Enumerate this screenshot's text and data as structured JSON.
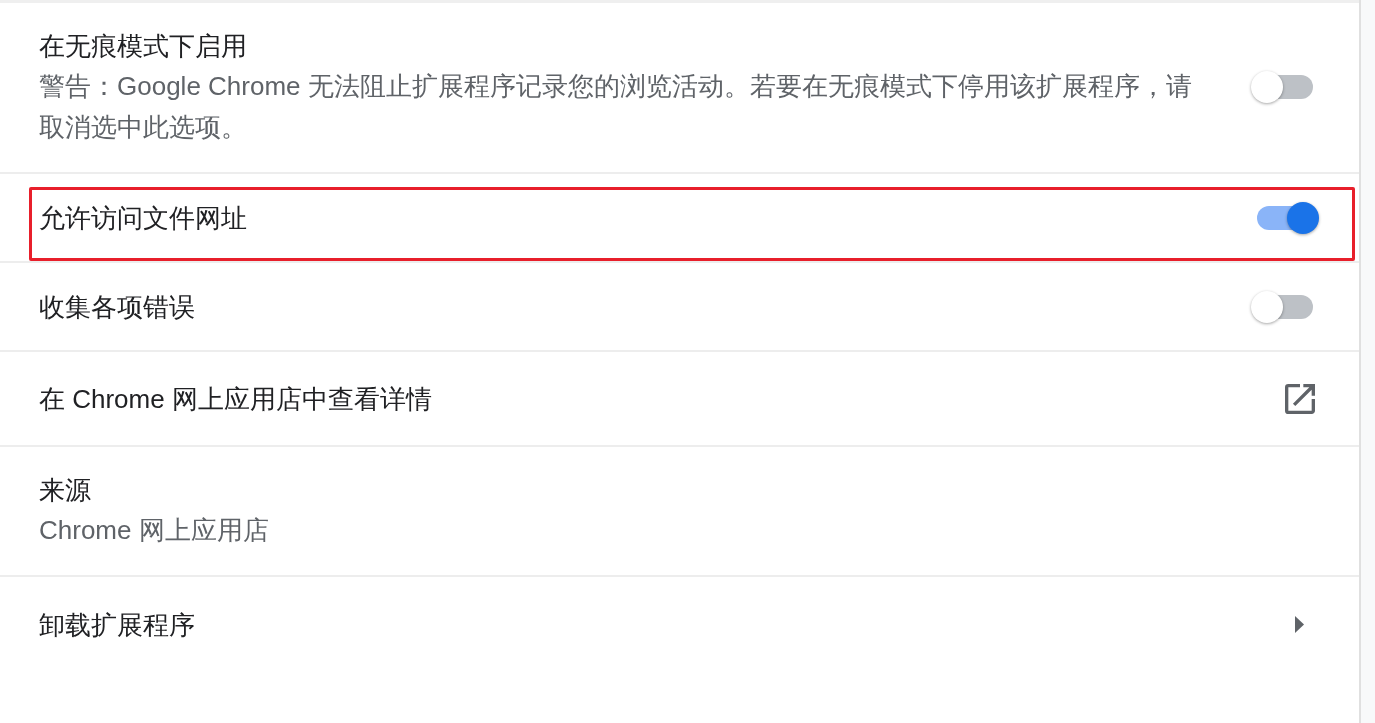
{
  "rows": [
    {
      "kind": "toggle",
      "title": "在无痕模式下启用",
      "description": "警告：Google Chrome 无法阻止扩展程序记录您的浏览活动。若要在无痕模式下停用该扩展程序，请取消选中此选项。",
      "on": false,
      "highlighted": false
    },
    {
      "kind": "toggle",
      "title": "允许访问文件网址",
      "on": true,
      "highlighted": true
    },
    {
      "kind": "toggle",
      "title": "收集各项错误",
      "on": false,
      "highlighted": false
    },
    {
      "kind": "link",
      "title": "在 Chrome 网上应用店中查看详情",
      "highlighted": false
    },
    {
      "kind": "info",
      "title": "来源",
      "description": "Chrome 网上应用店",
      "highlighted": false
    },
    {
      "kind": "submenu",
      "title": "卸载扩展程序",
      "highlighted": false
    }
  ]
}
